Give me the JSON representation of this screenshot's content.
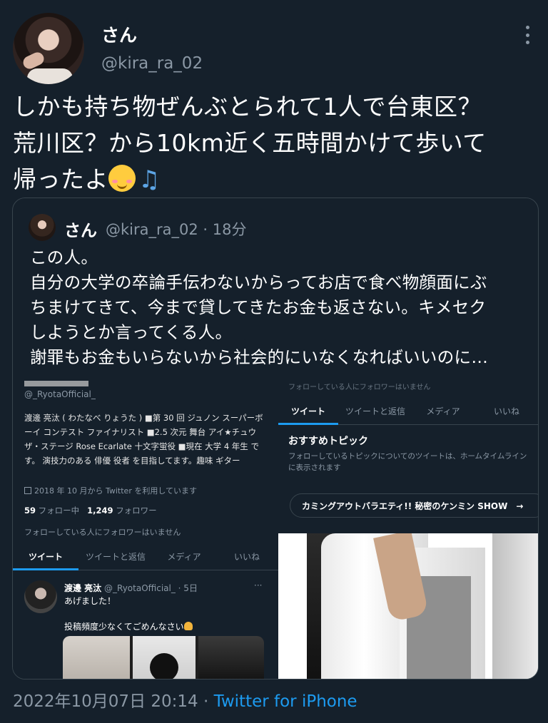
{
  "tweet": {
    "display_name": "さん",
    "handle": "@kira_ra_02",
    "text_lines": [
      "しかも持ち物ぜんぶとられて1人で台東区？",
      "荒川区？から10km近く五時間かけて歩いて",
      "帰ったよ"
    ],
    "emojis": [
      "blush-emoji",
      "musical-notes-emoji"
    ],
    "date": "2022年10月07日 20:14",
    "separator": "·",
    "source": "Twitter for iPhone"
  },
  "quote": {
    "display_name": "さん",
    "meta": "@kira_ra_02 · 18分",
    "lines": [
      "この人。",
      "自分の大学の卒論手伝わないからってお店で食べ物顔面にぶ",
      "ちまけてきて、今まで貸してきたお金も返さない。キメセク",
      "しようとか言ってくる人。",
      "謝罪もお金もいらないから社会的にいなくなればいいのに…"
    ]
  },
  "embedded_left": {
    "handle": "@_RyotaOfficial_",
    "bio": "渡邊 亮汰 ( わたなべ りょうた ) ■第 30 回 ジュノン スーパーボーイ コンテスト ファイナリスト ■2.5 次元 舞台 アイ★チュウ ザ・ステージ Rose Ecarlate 十文字蛍役 ■現在 大学 4 年生 です。 演技力のある 俳優 役者 を目指してます。趣味 ギター",
    "since": "2018 年 10 月から Twitter を利用しています",
    "following_count": "59",
    "following_label": "フォロー中",
    "followers_count": "1,249",
    "followers_label": "フォロワー",
    "no_followers": "フォローしている人にフォロワーはいません",
    "tabs": [
      "ツイート",
      "ツイートと返信",
      "メディア",
      "いいね"
    ],
    "tweet_name": "渡邊 亮汰",
    "tweet_meta": "@_RyotaOfficial_ · 5日",
    "tweet_more": "···",
    "tweet_line1": "あげました！",
    "tweet_line2": "投稿頻度少なくてごめんなさい"
  },
  "embedded_right": {
    "cut_text": "フォローしている人にフォロワーはいません",
    "tabs": [
      "ツイート",
      "ツイートと返信",
      "メディア",
      "いいね"
    ],
    "topic_title": "おすすめトピック",
    "topic_desc": "フォローしているトピックについてのツイートは、ホームタイムラインに表示されます",
    "chip": "カミングアウトバラエティ!! 秘密のケンミン SHOW　→"
  },
  "colors": {
    "background": "#15202b",
    "text": "#ffffff",
    "muted": "#8b98a5",
    "accent": "#1d9bf0",
    "border": "#38444d"
  }
}
